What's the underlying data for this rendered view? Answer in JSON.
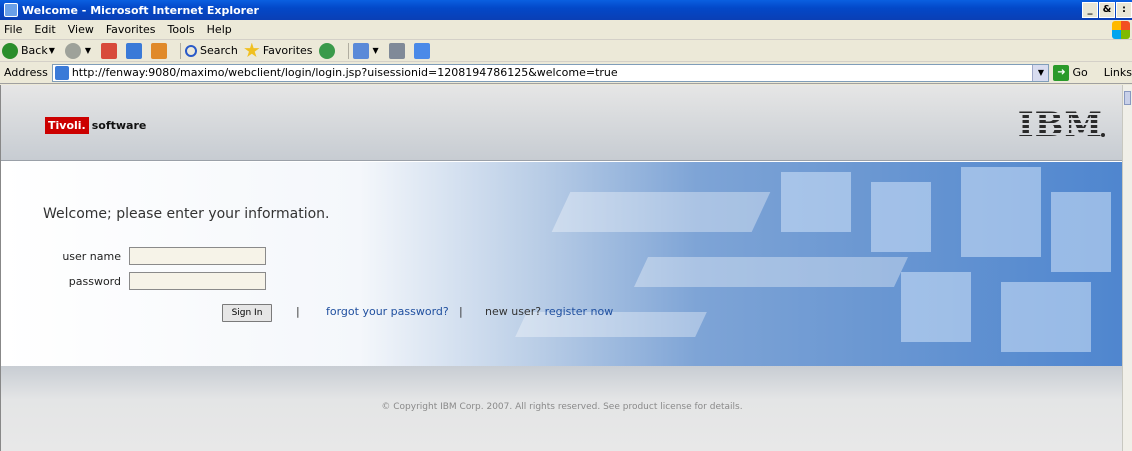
{
  "window": {
    "title": "Welcome - Microsoft Internet Explorer",
    "controls": [
      "_",
      "&",
      ":"
    ]
  },
  "menu": [
    "File",
    "Edit",
    "View",
    "Favorites",
    "Tools",
    "Help"
  ],
  "toolbar": {
    "back_label": "Back",
    "search_label": "Search",
    "favorites_label": "Favorites"
  },
  "address": {
    "label": "Address",
    "url": "http://fenway:9080/maximo/webclient/login/login.jsp?uisessionid=1208194786125&welcome=true",
    "go_label": "Go",
    "links_label": "Links"
  },
  "header": {
    "tivoli_brand": "Tivoli.",
    "tivoli_suffix": "software",
    "ibm_logo": "IBM"
  },
  "login": {
    "welcome_text": "Welcome; please enter your information.",
    "username_label": "user name",
    "password_label": "password",
    "username_value": "",
    "password_value": "",
    "signin_label": "Sign In",
    "separator": "|",
    "forgot_link": "forgot your password?",
    "new_user_text": "new user?",
    "register_link": "register now"
  },
  "footer": {
    "copyright": "© Copyright IBM Corp. 2007. All rights reserved. See product license for details."
  }
}
